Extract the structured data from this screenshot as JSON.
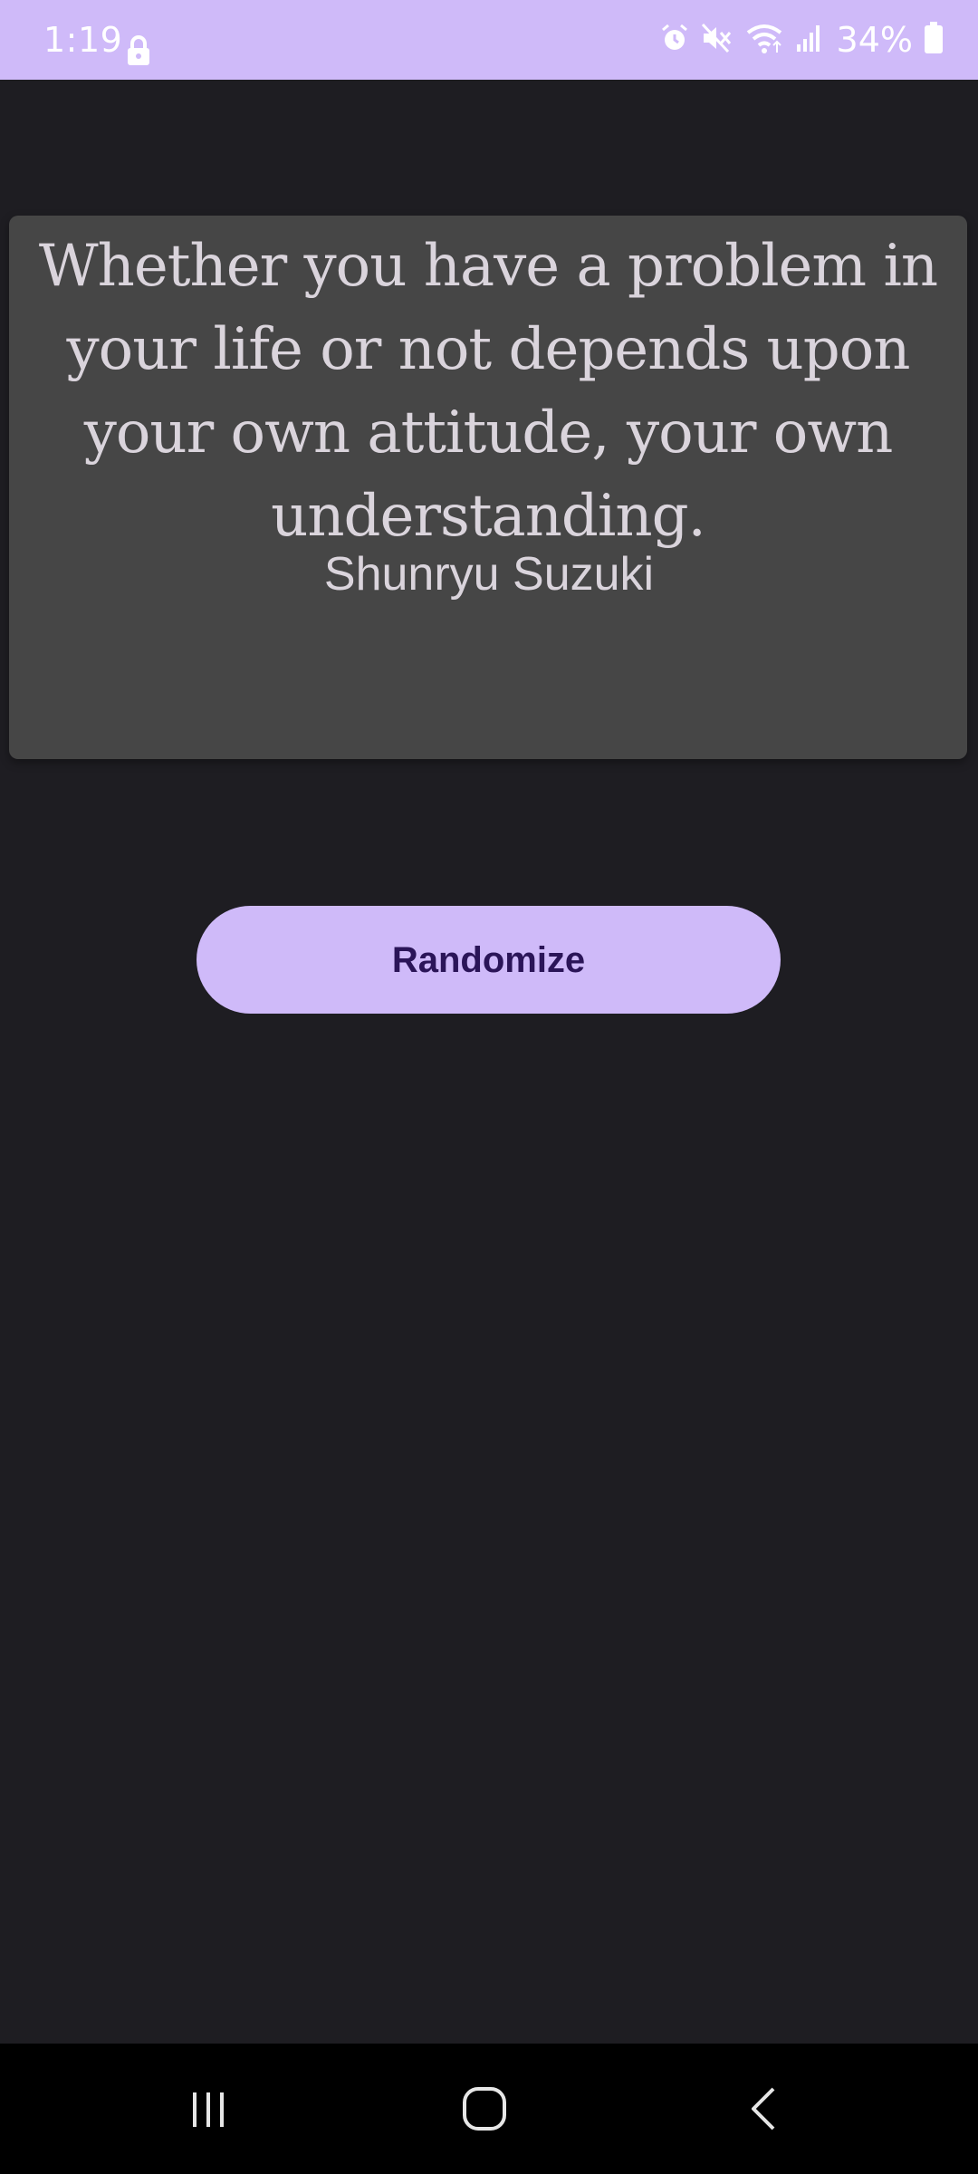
{
  "status_bar": {
    "time": "1:19",
    "battery": "34%",
    "icons": [
      "lock-icon",
      "alarm-icon",
      "mute-icon",
      "wifi-icon",
      "signal-icon",
      "battery-icon"
    ]
  },
  "quote": {
    "text": "Whether you have a problem in your life or not depends upon your own attitude, your own understanding.",
    "author": "Shunryu Suzuki"
  },
  "actions": {
    "randomize_label": "Randomize"
  },
  "nav": {
    "icons": [
      "recents-icon",
      "home-icon",
      "back-icon"
    ]
  },
  "colors": {
    "accent": "#cfbaf9",
    "background": "#1e1d22",
    "card": "#464646",
    "button_text": "#2b1558",
    "quote_text": "#dad4dc"
  }
}
